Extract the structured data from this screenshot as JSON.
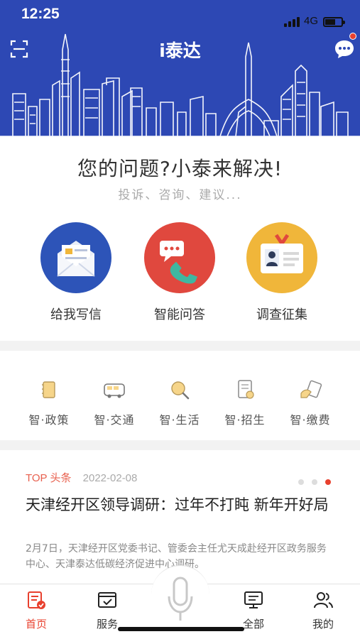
{
  "status_bar": {
    "time": "12:25",
    "network": "4G"
  },
  "header": {
    "title": "i泰达",
    "icons": [
      "scan-icon",
      "chat-icon"
    ]
  },
  "hero": {
    "title": "您的问题?小泰来解决!",
    "subtitle": "投诉、咨询、建议..."
  },
  "actions": [
    {
      "label": "给我写信",
      "icon": "envelope-icon",
      "color": "#2d54b8"
    },
    {
      "label": "智能问答",
      "icon": "phone-chat-icon",
      "color": "#e0483e"
    },
    {
      "label": "调查征集",
      "icon": "id-card-icon",
      "color": "#f0b63a"
    }
  ],
  "services": [
    {
      "label": "智·政策",
      "icon": "policy-book-icon"
    },
    {
      "label": "智·交通",
      "icon": "bus-icon"
    },
    {
      "label": "智·生活",
      "icon": "magnifier-icon"
    },
    {
      "label": "智·招生",
      "icon": "certificate-icon"
    },
    {
      "label": "智·缴费",
      "icon": "payment-icon"
    }
  ],
  "news": {
    "tag": "TOP 头条",
    "date": "2022-02-08",
    "title": "天津经开区领导调研：过年不打盹 新年开好局",
    "summary": "2月7日，天津经开区党委书记、管委会主任尤天成赴经开区政务服务中心、天津泰达低碳经济促进中心调研。",
    "carousel": {
      "pages": 3,
      "active": 3
    }
  },
  "tabbar": [
    {
      "label": "首页",
      "icon": "home-doc-icon",
      "active": true
    },
    {
      "label": "服务",
      "icon": "service-window-icon",
      "active": false
    },
    {
      "label": "",
      "icon": "microphone-icon",
      "active": false
    },
    {
      "label": "全部",
      "icon": "monitor-icon",
      "active": false
    },
    {
      "label": "我的",
      "icon": "user-group-icon",
      "active": false
    }
  ],
  "colors": {
    "brand_blue": "#2d48b4",
    "accent_red": "#e8402e",
    "top_tag": "#e8604e"
  }
}
